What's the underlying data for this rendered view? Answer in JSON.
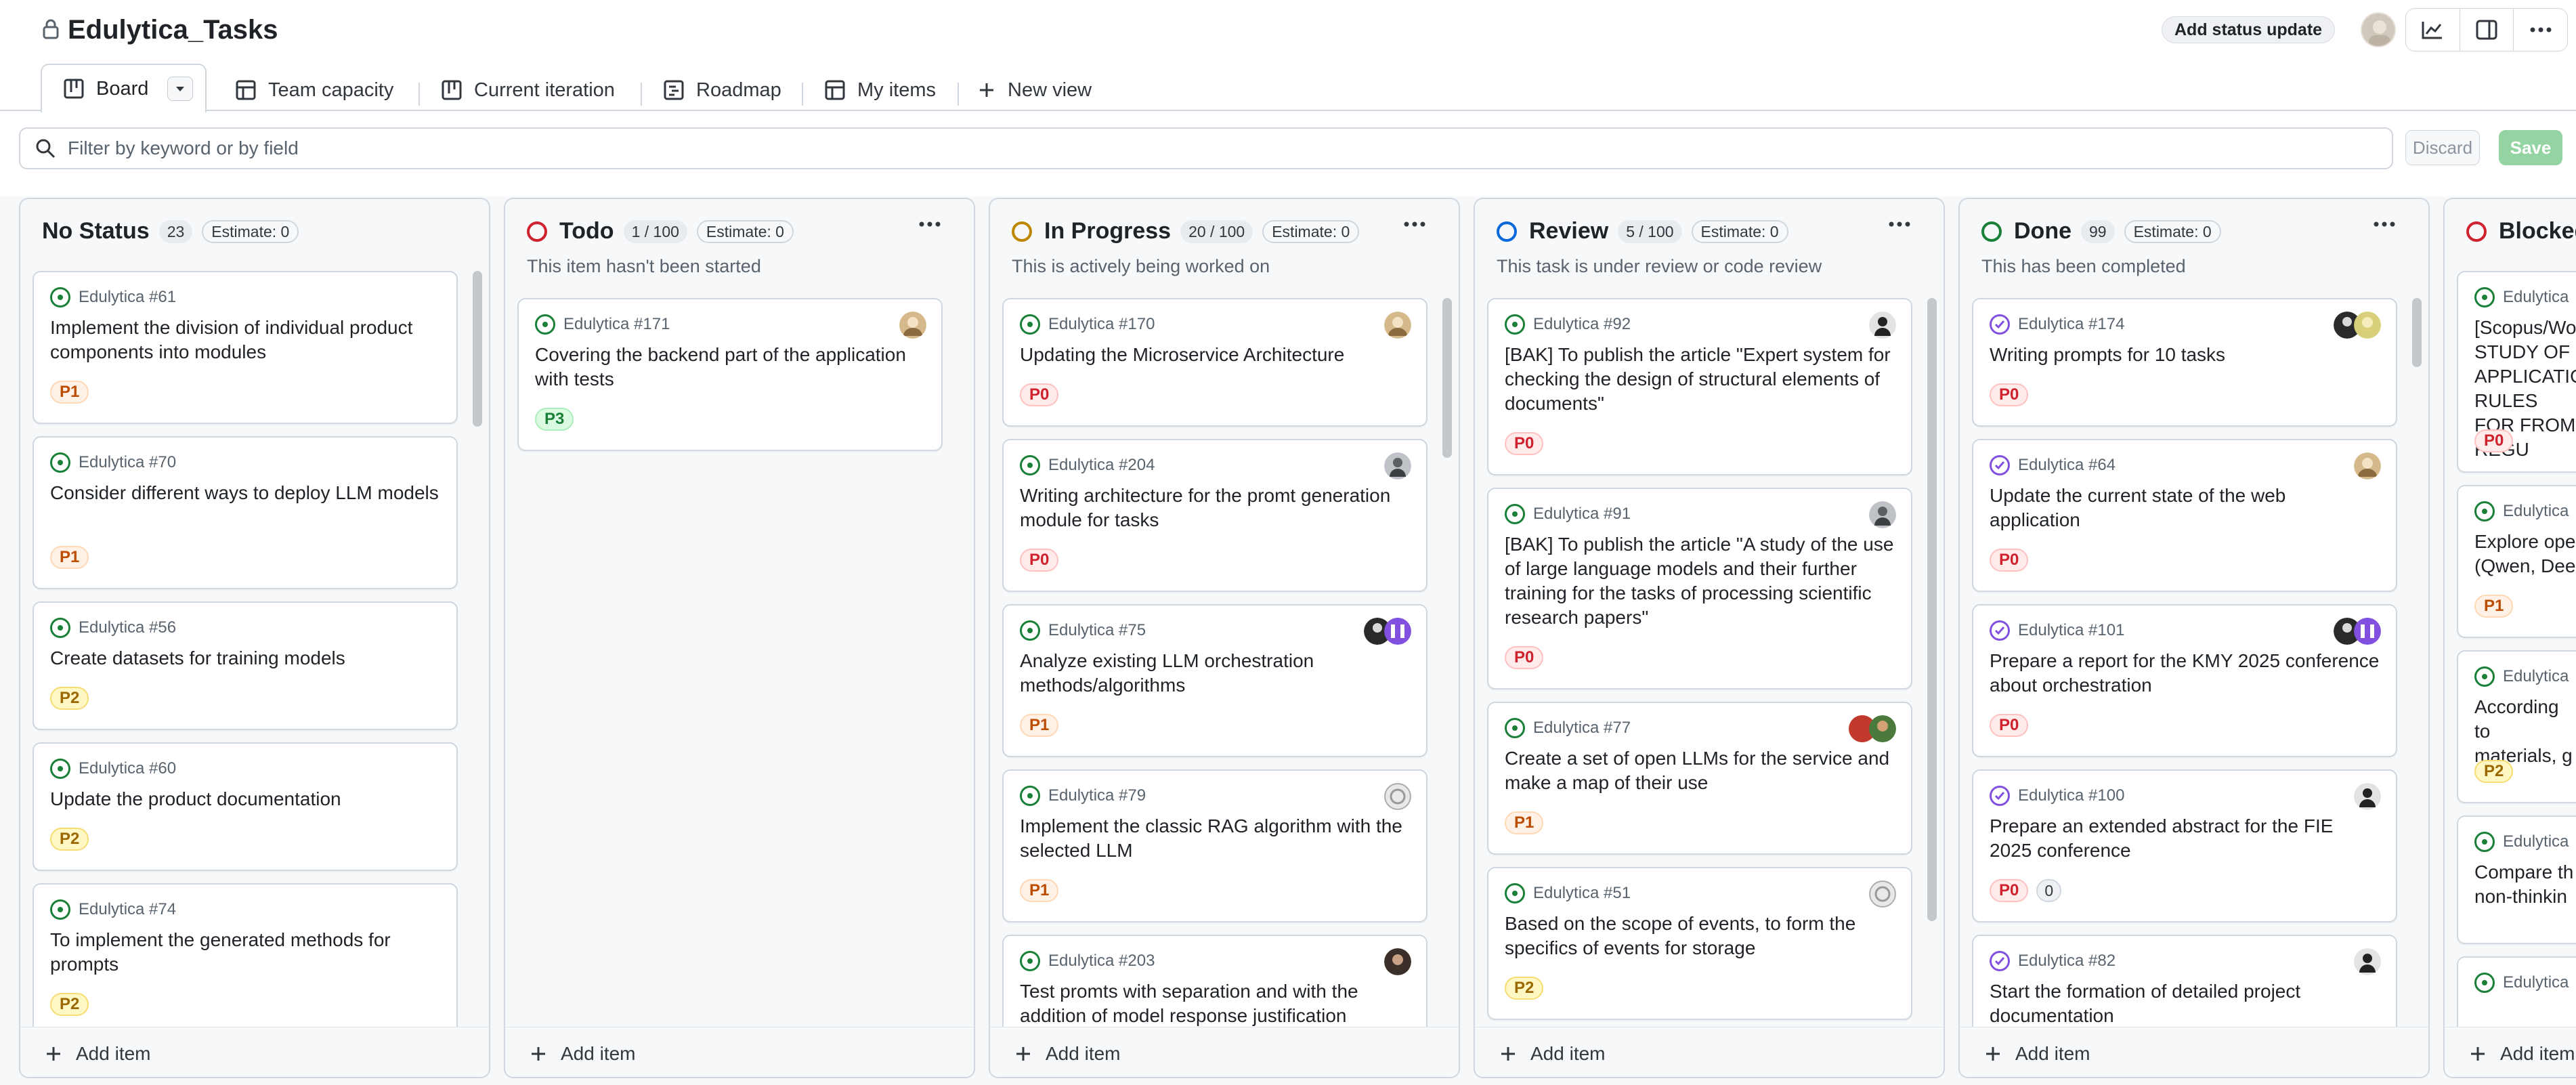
{
  "project": {
    "title": "Edulytica_Tasks"
  },
  "header": {
    "status_update": "Add status update"
  },
  "tabs": [
    {
      "label": "Board"
    },
    {
      "label": "Team capacity"
    },
    {
      "label": "Current iteration"
    },
    {
      "label": "Roadmap"
    },
    {
      "label": "My items"
    },
    {
      "label": "New view"
    }
  ],
  "filter": {
    "placeholder": "Filter by keyword or by field",
    "discard": "Discard",
    "save": "Save"
  },
  "colors": {
    "green": "#1a7f37",
    "red": "#cf222e",
    "yellow": "#bf8700",
    "blue": "#0969da",
    "purple": "#8250df"
  },
  "add_item": "Add item",
  "columns": [
    {
      "name": "No Status",
      "count": "23",
      "estimate": "Estimate: 0",
      "description": "",
      "cards": [
        {
          "ref": "Edulytica #61",
          "title": "Implement the division of individual product components into modules",
          "priority": "P1"
        },
        {
          "ref": "Edulytica #70",
          "title": "Consider different ways to deploy LLM models",
          "priority": "P1"
        },
        {
          "ref": "Edulytica #56",
          "title": "Create datasets for training models",
          "priority": "P2"
        },
        {
          "ref": "Edulytica #60",
          "title": "Update the product documentation",
          "priority": "P2"
        },
        {
          "ref": "Edulytica #74",
          "title": "To implement the generated methods for prompts",
          "priority": "P2"
        }
      ]
    },
    {
      "name": "Todo",
      "count": "1 / 100",
      "estimate": "Estimate: 0",
      "description": "This item hasn't been started",
      "cards": [
        {
          "ref": "Edulytica #171",
          "title": "Covering the backend part of the application with tests",
          "priority": "P3"
        }
      ]
    },
    {
      "name": "In Progress",
      "count": "20 / 100",
      "estimate": "Estimate: 0",
      "description": "This is actively being worked on",
      "cards": [
        {
          "ref": "Edulytica #170",
          "title": "Updating the Microservice Architecture",
          "priority": "P0"
        },
        {
          "ref": "Edulytica #204",
          "title": "Writing architecture for the promt generation module for tasks",
          "priority": "P0"
        },
        {
          "ref": "Edulytica #75",
          "title": "Analyze existing LLM orchestration methods/algorithms",
          "priority": "P1"
        },
        {
          "ref": "Edulytica #79",
          "title": "Implement the classic RAG algorithm with the selected LLM",
          "priority": "P1"
        },
        {
          "ref": "Edulytica #203",
          "title": "Test promts with separation and with the addition of model response justification",
          "priority": ""
        }
      ]
    },
    {
      "name": "Review",
      "count": "5 / 100",
      "estimate": "Estimate: 0",
      "description": "This task is under review or code review",
      "cards": [
        {
          "ref": "Edulytica #92",
          "title": "[BAK] To publish the article \"Expert system for checking the design of structural elements of documents\"",
          "priority": "P0"
        },
        {
          "ref": "Edulytica #91",
          "title": "[BAK] To publish the article \"A study of the use of large language models and their further training for the tasks of processing scientific research papers\"",
          "priority": "P0"
        },
        {
          "ref": "Edulytica #77",
          "title": "Create a set of open LLMs for the service and make a map of their use",
          "priority": "P1"
        },
        {
          "ref": "Edulytica #51",
          "title": "Based on the scope of events, to form the specifics of events for storage",
          "priority": "P2"
        }
      ]
    },
    {
      "name": "Done",
      "count": "99",
      "estimate": "Estimate: 0",
      "description": "This has been completed",
      "cards": [
        {
          "ref": "Edulytica #174",
          "title": "Writing prompts for 10 tasks",
          "priority": "P0"
        },
        {
          "ref": "Edulytica #64",
          "title": "Update the current state of the web application",
          "priority": "P0"
        },
        {
          "ref": "Edulytica #101",
          "title": "Prepare a report for the KMY 2025 conference about orchestration",
          "priority": "P0"
        },
        {
          "ref": "Edulytica #100",
          "title": "Prepare an extended abstract for the FIE 2025 conference",
          "priority": "P0",
          "estimate": "0"
        },
        {
          "ref": "Edulytica #82",
          "title": "Start the formation of detailed project documentation",
          "priority": ""
        }
      ]
    },
    {
      "name": "Blocked",
      "cards": [
        {
          "ref": "Edulytica",
          "title": "[Scopus/Wo STUDY OF APPLICATIO RULES FOR FROM REGU",
          "priority": "P0"
        },
        {
          "ref": "Edulytica",
          "title": "Explore ope (Qwen, Dee",
          "priority": "P1"
        },
        {
          "ref": "Edulytica",
          "title": "According to materials, g",
          "priority": "P2"
        },
        {
          "ref": "Edulytica",
          "title": "Compare th non-thinkin",
          "priority": ""
        },
        {
          "ref": "Edulytica",
          "title": "",
          "priority": ""
        }
      ]
    }
  ]
}
